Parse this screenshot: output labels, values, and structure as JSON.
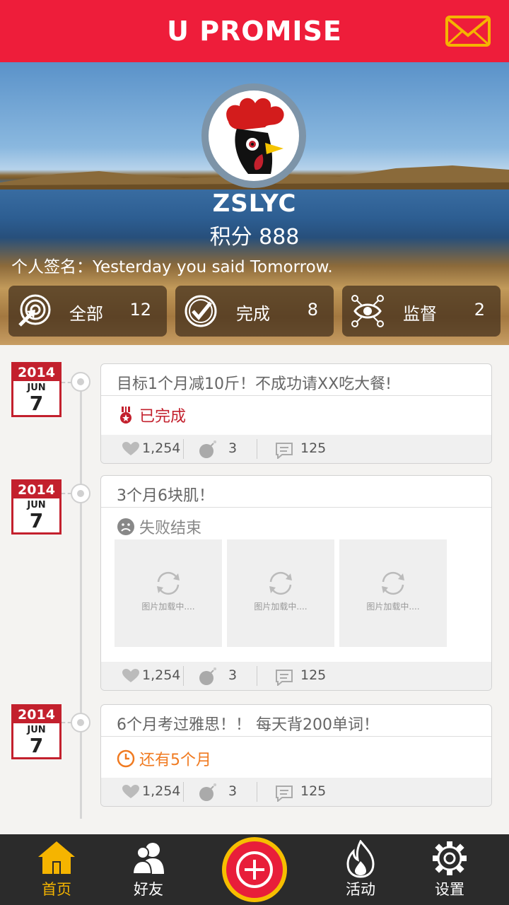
{
  "app": {
    "title": "U PROMISE"
  },
  "profile": {
    "username": "ZSLYC",
    "score": "积分 888",
    "signature": "个人签名：Yesterday you said Tomorrow."
  },
  "stats": [
    {
      "label": "全部",
      "count": "12",
      "icon": "all-icon"
    },
    {
      "label": "完成",
      "count": "8",
      "icon": "check-icon"
    },
    {
      "label": "监督",
      "count": "2",
      "icon": "eye-icon"
    }
  ],
  "timeline": [
    {
      "date": {
        "year": "2014",
        "month": "JUN",
        "day": "7"
      },
      "title": "目标1个月减10斤！不成功请XX吃大餐!",
      "status": "已完成",
      "status_color": "#c3202d",
      "status_icon": "medal-icon",
      "likes": "1,254",
      "bombs": "3",
      "comments": "125"
    },
    {
      "date": {
        "year": "2014",
        "month": "JUN",
        "day": "7"
      },
      "title": "3个月6块肌！",
      "status": "失败结束",
      "status_color": "#888888",
      "status_icon": "sad-face-icon",
      "images": [
        "图片加载中....",
        "图片加载中....",
        "图片加载中...."
      ],
      "likes": "1,254",
      "bombs": "3",
      "comments": "125"
    },
    {
      "date": {
        "year": "2014",
        "month": "JUN",
        "day": "7"
      },
      "title": "6个月考过雅思！！ 每天背200单词！",
      "status": "还有5个月",
      "status_color": "#f07a20",
      "status_icon": "clock-icon",
      "likes": "1,254",
      "bombs": "3",
      "comments": "125"
    }
  ],
  "nav": {
    "home": "首页",
    "friends": "好友",
    "activity": "活动",
    "settings": "设置"
  },
  "colors": {
    "brand_red": "#ee1d3a",
    "accent_yellow": "#f5b400",
    "nav_bg": "#2b2b2b"
  }
}
